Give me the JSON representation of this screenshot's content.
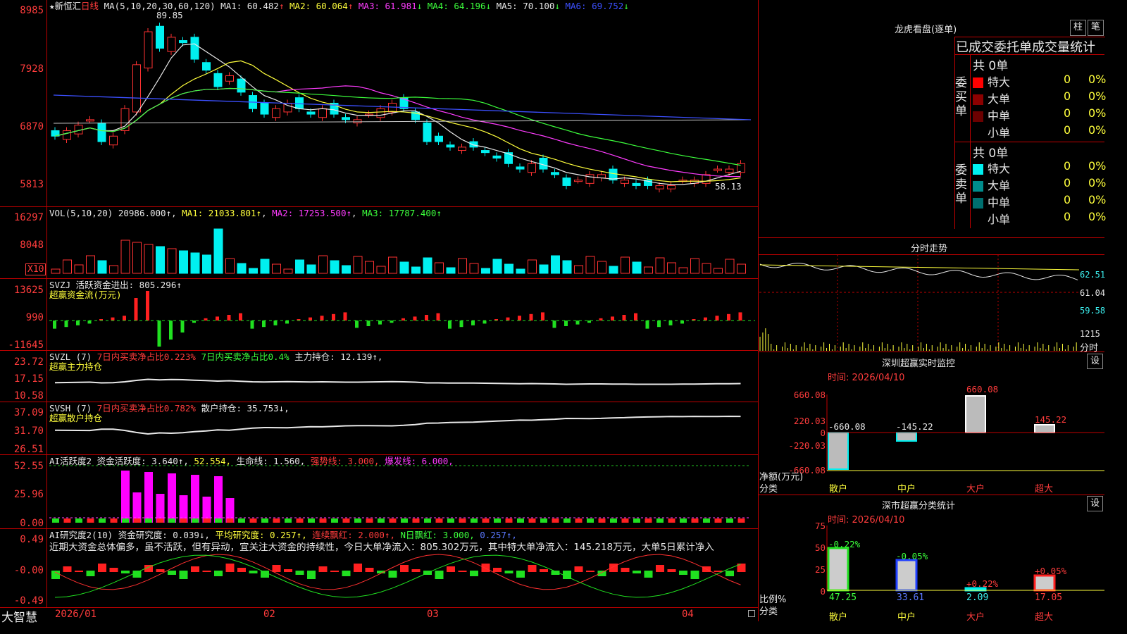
{
  "stock": {
    "name": "新恒汇",
    "star": "★",
    "period": "日线"
  },
  "colors": {
    "up": "#ff3232",
    "down": "#00f0f0",
    "frame": "#c00000",
    "label": "#ff3c3c"
  },
  "main": {
    "ma_label": "MA(5,10,20,30,60,120)",
    "ma": [
      {
        "label": "MA1: 60.482",
        "color": "#e8e8e8",
        "arrow": "↑"
      },
      {
        "label": "MA2: 60.064",
        "color": "#ffff3c",
        "arrow": "↑"
      },
      {
        "label": "MA3: 61.981",
        "color": "#ff3cff",
        "arrow": "↓"
      },
      {
        "label": "MA4: 64.196",
        "color": "#3cff3c",
        "arrow": "↓"
      },
      {
        "label": "MA5: 70.100",
        "color": "#e8e8e8",
        "arrow": "↓"
      },
      {
        "label": "MA6: 69.752",
        "color": "#3c50ff",
        "arrow": "↓"
      }
    ],
    "y_labels": [
      "8985",
      "7928",
      "6870",
      "5813"
    ],
    "high_mark": "89.85",
    "low_mark": "58.13"
  },
  "vol": {
    "title": "VOL(5,10,20)",
    "value": "20986.000↑",
    "ma1": "MA1: 21033.801↑",
    "ma2": "MA2: 17253.500↑",
    "ma3": "MA3: 17787.400↑",
    "y_labels": [
      "16297",
      "8048"
    ],
    "unit": "X10"
  },
  "svzj": {
    "title": "SVZJ  活跃资金进出: 805.296↑",
    "subtitle": "超赢资金流(万元)",
    "y_labels": [
      "13625",
      "990",
      "-11645"
    ]
  },
  "svzl": {
    "title": "SVZL (7)",
    "a": "7日内买卖净占比0.223%",
    "b": "7日内买卖净占比0.4%",
    "c": "主力持仓: 12.139↑,",
    "subtitle": "超赢主力持仓",
    "y_labels": [
      "23.72",
      "17.15",
      "10.58"
    ]
  },
  "svsh": {
    "title": "SVSH (7)",
    "a": "7日内买卖净占比0.782%",
    "c": "散户持仓: 35.753↓,",
    "subtitle": "超赢散户持仓",
    "y_labels": [
      "37.09",
      "31.70",
      "26.51"
    ]
  },
  "ai1": {
    "title": "AI活跃度2",
    "a": "资金活跃度: 3.640↑,",
    "b": "52.554,",
    "c": "生命线: 1.560,",
    "d": "强势线: 3.000,",
    "e": "爆发线: 6.000,",
    "y_labels": [
      "52.55",
      "25.96",
      "0.00"
    ]
  },
  "ai2": {
    "title": "AI研究度2(10)",
    "a": "资金研究度: 0.039↓,",
    "b": "平均研究度: 0.257↑,",
    "c": "连续飘红: 2.000↑,",
    "d": "N日飘红: 3.000,",
    "e": "0.257↑,",
    "comment": "近期大资金总体偏多，虽不活跃，但有异动，宜关注大资金的持续性，今日大单净流入：805.302万元，其中特大单净流入：145.218万元，大单5日累计净入",
    "y_labels": [
      "0.49",
      "-0.00",
      "-0.49"
    ]
  },
  "xaxis": {
    "brand": "大智慧",
    "labels": [
      "2026/01",
      "02",
      "03",
      "04"
    ]
  },
  "right": {
    "lhb_title": "龙虎看盘(逐单)",
    "btn_zhu": "柱",
    "btn_bi": "笔",
    "stat_title": "已成交委托单成交量统计",
    "buy_label": "委买单",
    "sell_label": "委卖单",
    "buy_total": "共 0单",
    "sell_total": "共 0单",
    "buy_rows": [
      {
        "name": "特大",
        "count": "0",
        "pct": "0%",
        "color": "#ff0000"
      },
      {
        "name": "大单",
        "count": "0",
        "pct": "0%",
        "color": "#8b0000"
      },
      {
        "name": "中单",
        "count": "0",
        "pct": "0%",
        "color": "#6b0000"
      },
      {
        "name": "小单",
        "count": "0",
        "pct": "0%",
        "color": "#000000"
      }
    ],
    "sell_rows": [
      {
        "name": "特大",
        "count": "0",
        "pct": "0%",
        "color": "#00f0f0"
      },
      {
        "name": "大单",
        "count": "0",
        "pct": "0%",
        "color": "#008c8c"
      },
      {
        "name": "中单",
        "count": "0",
        "pct": "0%",
        "color": "#007070"
      },
      {
        "name": "小单",
        "count": "0",
        "pct": "0%",
        "color": "#000000"
      }
    ],
    "fenshi_title": "分时走势",
    "fenshi_labels": [
      "62.51",
      "61.04",
      "59.58",
      "1215",
      "分时"
    ],
    "sz_title": "深圳超赢实时监控",
    "btn_set": "设",
    "time_label": "时间: 2026/04/10",
    "sz_y": [
      "660.08",
      "220.03",
      "0",
      "-220.03",
      "-660.08"
    ],
    "sz_vals": [
      "-660.08",
      "-145.22",
      "660.08",
      "145.22"
    ],
    "sz_ylabel": "净额(万元)",
    "cat_label": "分类",
    "cats": [
      "散户",
      "中户",
      "大户",
      "超大"
    ],
    "ss_title": "深市超赢分类统计",
    "ss_time": "时间: 2026/04/10",
    "ss_y": [
      "75",
      "50",
      "25",
      "0"
    ],
    "ss_top": [
      "-0.22%",
      "-0.05%",
      "+0.22%",
      "+0.05%"
    ],
    "ss_vals": [
      "47.25",
      "33.61",
      "2.09",
      "17.05"
    ],
    "ss_ylabel": "比例%"
  }
}
